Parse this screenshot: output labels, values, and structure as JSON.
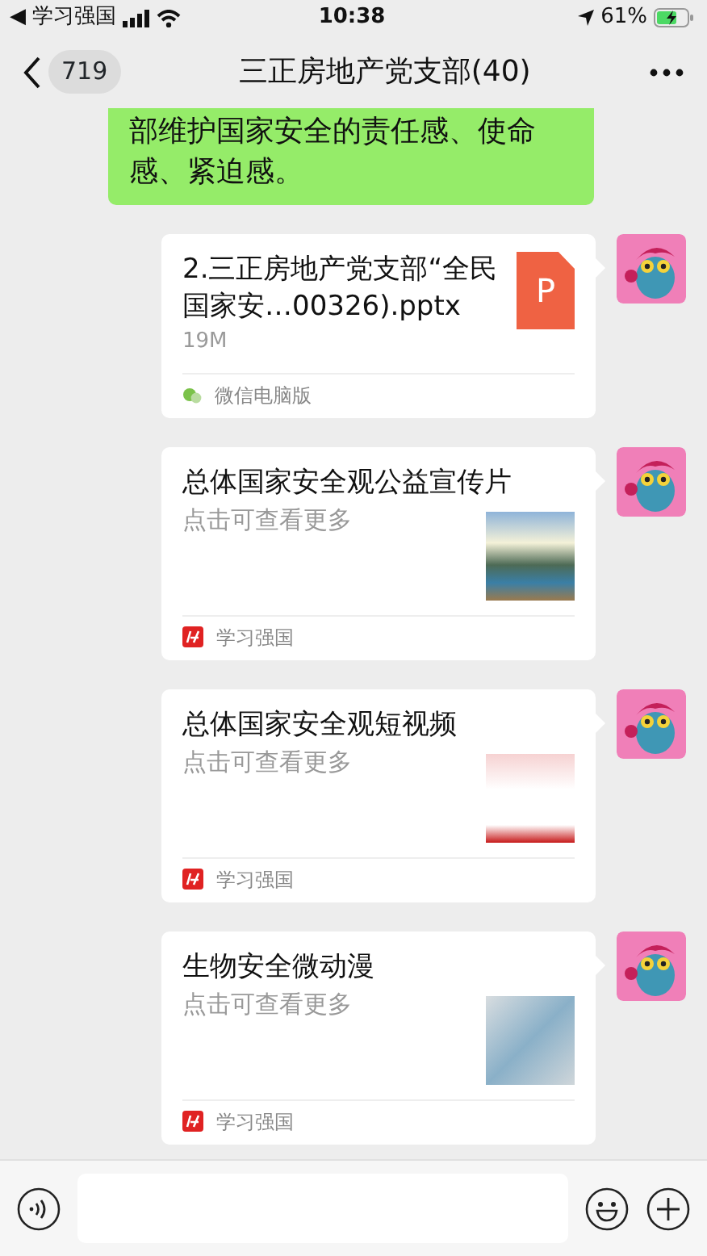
{
  "status_bar": {
    "back_arrow": "◀",
    "back_app": "学习强国",
    "time": "10:38",
    "battery_percent": "61%"
  },
  "header": {
    "unread_count": "719",
    "title": "三正房地产党支部(40)"
  },
  "sent_text": {
    "text": "部维护国家安全的责任感、使命感、紧迫感。"
  },
  "messages": [
    {
      "kind": "file",
      "title": "2.三正房地产党支部“全民国家安…00326).pptx",
      "file_size": "19M",
      "file_icon_letter": "P",
      "source": "微信电脑版"
    },
    {
      "kind": "link",
      "title": "总体国家安全观公益宣传片",
      "description": "点击可查看更多",
      "source": "学习强国"
    },
    {
      "kind": "link",
      "title": "总体国家安全观短视频",
      "description": "点击可查看更多",
      "source": "学习强国"
    },
    {
      "kind": "link",
      "title": "生物安全微动漫",
      "description": "点击可查看更多",
      "source": "学习强国"
    }
  ]
}
